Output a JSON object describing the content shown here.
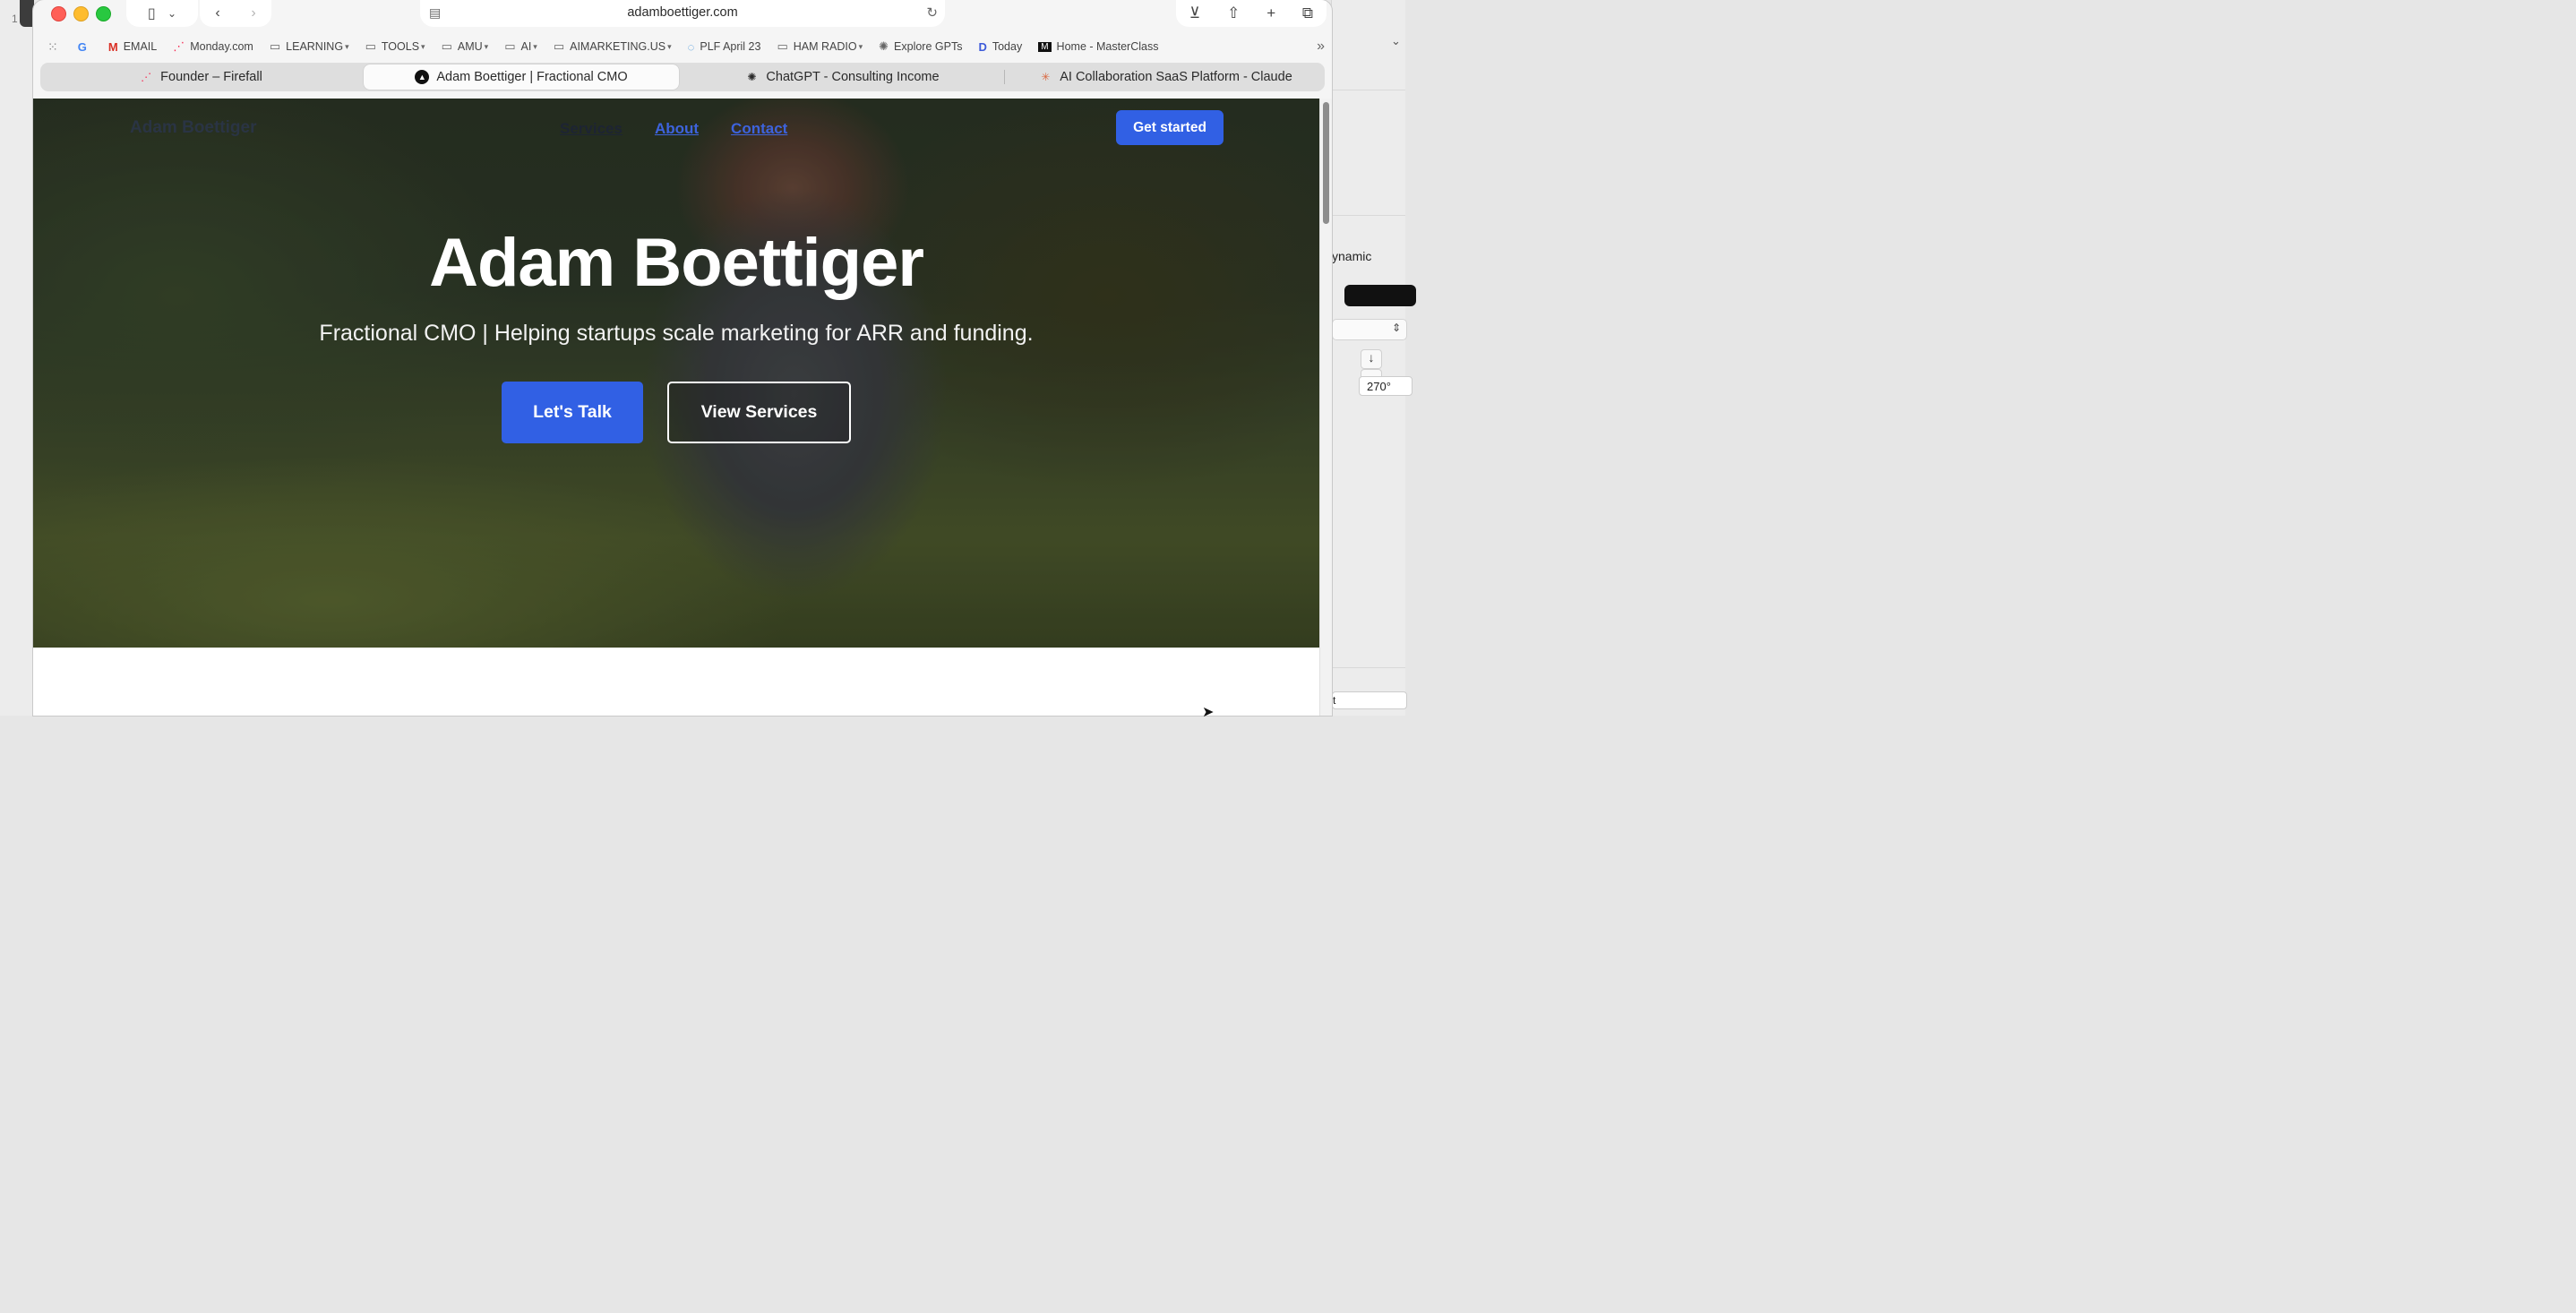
{
  "desktop": {
    "left_label": "1"
  },
  "browser": {
    "url": "adamboettiger.com",
    "bookmarks": [
      {
        "label": "",
        "icon": "google-icon"
      },
      {
        "label": "EMAIL",
        "icon": "gmail-icon"
      },
      {
        "label": "Monday.com",
        "icon": "monday-icon"
      },
      {
        "label": "LEARNING",
        "icon": "folder-icon",
        "menu": true
      },
      {
        "label": "TOOLS",
        "icon": "folder-icon",
        "menu": true
      },
      {
        "label": "AMU",
        "icon": "folder-icon",
        "menu": true
      },
      {
        "label": "AI",
        "icon": "folder-icon",
        "menu": true
      },
      {
        "label": "AIMARKETING.US",
        "icon": "folder-icon",
        "menu": true
      },
      {
        "label": "PLF April 23",
        "icon": "circle-icon"
      },
      {
        "label": "HAM RADIO",
        "icon": "folder-icon",
        "menu": true
      },
      {
        "label": "Explore GPTs",
        "icon": "openai-icon"
      },
      {
        "label": "Today",
        "icon": "today-icon"
      },
      {
        "label": "Home - MasterClass",
        "icon": "masterclass-icon"
      }
    ],
    "tabs": [
      {
        "label": "Founder – Firefall",
        "icon": "monday-icon"
      },
      {
        "label": "Adam Boettiger | Fractional CMO",
        "icon": "triangle-icon",
        "active": true
      },
      {
        "label": "ChatGPT - Consulting Income",
        "icon": "openai-icon"
      },
      {
        "label": "AI Collaboration SaaS Platform - Claude",
        "icon": "claude-icon"
      }
    ]
  },
  "site": {
    "brand": "Adam Boettiger",
    "nav": {
      "services": "Services",
      "about": "About",
      "contact": "Contact"
    },
    "cta_top": "Get started",
    "hero": {
      "title": "Adam Boettiger",
      "subtitle": "Fractional CMO | Helping startups scale marketing for ARR and funding.",
      "primary_cta": "Let's Talk",
      "secondary_cta": "View Services"
    }
  },
  "inspector": {
    "mode_label": "ynamic",
    "angle_value": "270°",
    "bottom_field": "t"
  },
  "colors": {
    "accent": "#3160e4",
    "link": "#3d63dd"
  }
}
